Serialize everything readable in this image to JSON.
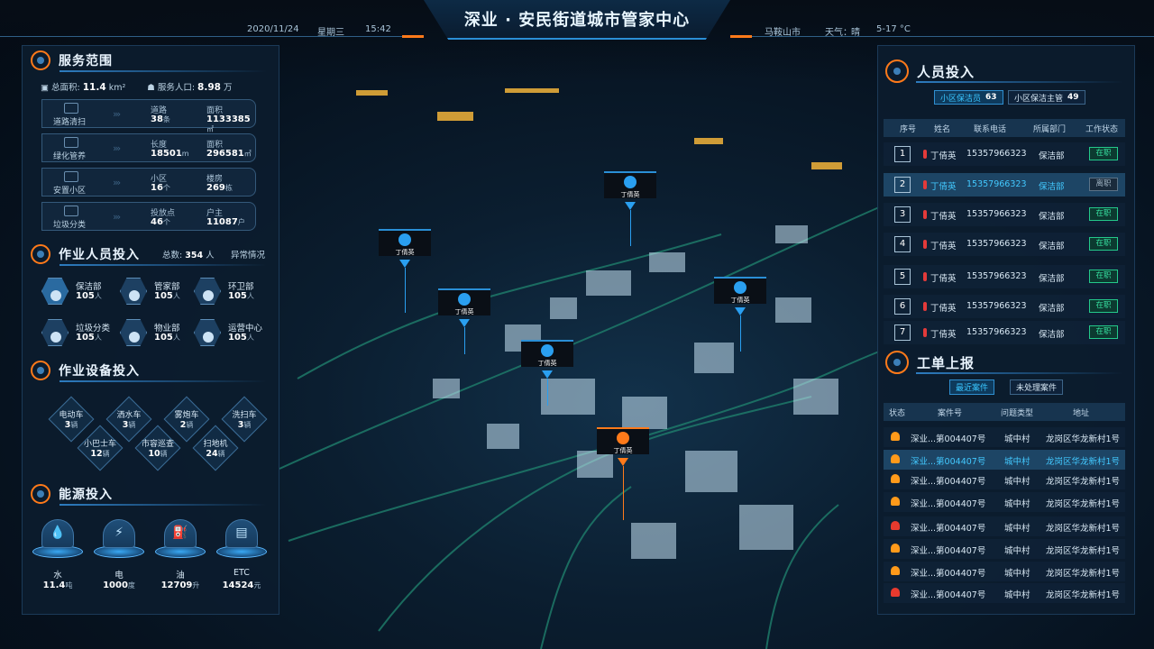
{
  "header": {
    "title": "深业 · 安民街道城市管家中心",
    "date": "2020/11/24",
    "weekday": "星期三",
    "time": "15:42",
    "city": "马鞍山市",
    "weather_label": "天气：",
    "weather": "晴",
    "temperature": "5-17 °C"
  },
  "service": {
    "title": "服务范围",
    "area_label": "总面积:",
    "area_value": "11.4",
    "area_unit": "km²",
    "pop_label": "服务人口:",
    "pop_value": "8.98",
    "pop_unit": "万",
    "rows": [
      {
        "icon": "road-icon",
        "name": "道路清扫",
        "k1": "道路",
        "v1": "38",
        "u1": "条",
        "k2": "面积",
        "v2": "1133385",
        "u2": "㎡"
      },
      {
        "icon": "tree-icon",
        "name": "绿化管养",
        "k1": "长度",
        "v1": "18501",
        "u1": "m",
        "k2": "面积",
        "v2": "296581",
        "u2": "㎡"
      },
      {
        "icon": "building-icon",
        "name": "安置小区",
        "k1": "小区",
        "v1": "16",
        "u1": "个",
        "k2": "楼房",
        "v2": "269",
        "u2": "栋"
      },
      {
        "icon": "sort-icon",
        "name": "垃圾分类",
        "k1": "投放点",
        "v1": "46",
        "u1": "个",
        "k2": "户主",
        "v2": "11087",
        "u2": "户"
      }
    ]
  },
  "staff": {
    "title": "作业人员投入",
    "total_label": "总数:",
    "total_value": "354",
    "total_unit": "人",
    "abnormal": "异常情况",
    "items": [
      {
        "icon": "cleaner-icon",
        "name": "保洁部",
        "value": "105",
        "unit": "人"
      },
      {
        "icon": "manager-icon",
        "name": "管家部",
        "value": "105",
        "unit": "人"
      },
      {
        "icon": "recycle-icon",
        "name": "环卫部",
        "value": "105",
        "unit": "人"
      },
      {
        "icon": "garbage-sort-icon",
        "name": "垃圾分类",
        "value": "105",
        "unit": "人"
      },
      {
        "icon": "property-icon",
        "name": "物业部",
        "value": "105",
        "unit": "人"
      },
      {
        "icon": "operation-icon",
        "name": "运营中心",
        "value": "105",
        "unit": "人"
      }
    ]
  },
  "equipment": {
    "title": "作业设备投入",
    "items": [
      {
        "name": "电动车",
        "value": "3",
        "unit": "辆"
      },
      {
        "name": "洒水车",
        "value": "3",
        "unit": "辆"
      },
      {
        "name": "雾炮车",
        "value": "2",
        "unit": "辆"
      },
      {
        "name": "洗扫车",
        "value": "3",
        "unit": "辆"
      },
      {
        "name": "小巴士车",
        "value": "12",
        "unit": "辆"
      },
      {
        "name": "市容巡查",
        "value": "10",
        "unit": "辆"
      },
      {
        "name": "扫地机",
        "value": "24",
        "unit": "辆"
      }
    ]
  },
  "energy": {
    "title": "能源投入",
    "items": [
      {
        "icon": "water-icon",
        "glyph": "💧",
        "name": "水",
        "value": "11.4",
        "unit": "吨"
      },
      {
        "icon": "electric-icon",
        "glyph": "⚡",
        "name": "电",
        "value": "1000",
        "unit": "度"
      },
      {
        "icon": "fuel-icon",
        "glyph": "⛽",
        "name": "油",
        "value": "12709",
        "unit": "升"
      },
      {
        "icon": "etc-icon",
        "glyph": "▤",
        "name": "ETC",
        "value": "14524",
        "unit": "元"
      }
    ]
  },
  "map_markers": [
    {
      "name": "丁倩英",
      "color": "blue"
    },
    {
      "name": "丁倩英",
      "color": "blue"
    },
    {
      "name": "丁倩英",
      "color": "blue"
    },
    {
      "name": "丁倩英",
      "color": "blue"
    },
    {
      "name": "丁倩英",
      "color": "blue"
    },
    {
      "name": "丁倩英",
      "color": "orange"
    }
  ],
  "personnel": {
    "title": "人员投入",
    "tab1_label": "小区保洁员",
    "tab1_count": "63",
    "tab2_label": "小区保洁主管",
    "tab2_count": "49",
    "columns": [
      "序号",
      "姓名",
      "联系电话",
      "所属部门",
      "工作状态"
    ],
    "rows": [
      {
        "no": "1",
        "name": "丁倩英",
        "phone": "15357966323",
        "dept": "保洁部",
        "status": "在职"
      },
      {
        "no": "2",
        "name": "丁倩英",
        "phone": "15357966323",
        "dept": "保洁部",
        "status": "离职"
      },
      {
        "no": "3",
        "name": "丁倩英",
        "phone": "15357966323",
        "dept": "保洁部",
        "status": "在职"
      },
      {
        "no": "4",
        "name": "丁倩英",
        "phone": "15357966323",
        "dept": "保洁部",
        "status": "在职"
      },
      {
        "no": "5",
        "name": "丁倩英",
        "phone": "15357966323",
        "dept": "保洁部",
        "status": "在职"
      },
      {
        "no": "6",
        "name": "丁倩英",
        "phone": "15357966323",
        "dept": "保洁部",
        "status": "在职"
      },
      {
        "no": "7",
        "name": "丁倩英",
        "phone": "15357966323",
        "dept": "保洁部",
        "status": "在职"
      }
    ]
  },
  "workorders": {
    "title": "工单上报",
    "tab_recent": "最近案件",
    "tab_pending": "未处理案件",
    "columns": [
      "状态",
      "案件号",
      "问题类型",
      "地址"
    ],
    "rows": [
      {
        "alert": "orange",
        "case": "深业...第004407号",
        "type": "城中村",
        "addr": "龙岗区华龙新村1号"
      },
      {
        "alert": "orange",
        "case": "深业...第004407号",
        "type": "城中村",
        "addr": "龙岗区华龙新村1号"
      },
      {
        "alert": "orange",
        "case": "深业...第004407号",
        "type": "城中村",
        "addr": "龙岗区华龙新村1号"
      },
      {
        "alert": "orange",
        "case": "深业...第004407号",
        "type": "城中村",
        "addr": "龙岗区华龙新村1号"
      },
      {
        "alert": "red",
        "case": "深业...第004407号",
        "type": "城中村",
        "addr": "龙岗区华龙新村1号"
      },
      {
        "alert": "orange",
        "case": "深业...第004407号",
        "type": "城中村",
        "addr": "龙岗区华龙新村1号"
      },
      {
        "alert": "orange",
        "case": "深业...第004407号",
        "type": "城中村",
        "addr": "龙岗区华龙新村1号"
      },
      {
        "alert": "red",
        "case": "深业...第004407号",
        "type": "城中村",
        "addr": "龙岗区华龙新村1号"
      }
    ]
  },
  "colors": {
    "accent": "#ff7a1a",
    "primary": "#2a9ff0",
    "highlight": "#43c9ff",
    "success": "#37e0a0"
  }
}
